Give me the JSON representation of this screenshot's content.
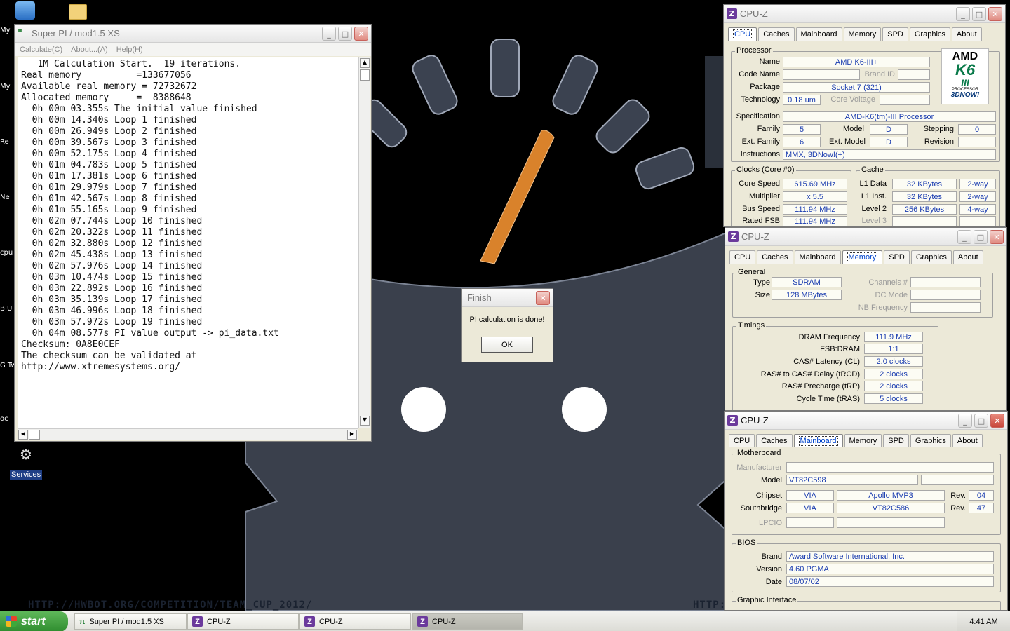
{
  "desktop": {
    "icons": [
      "My",
      "My",
      "Re",
      "Ne",
      "cpu",
      "B U",
      "G Tw",
      "oc"
    ],
    "services_label": "Services",
    "wallpaper_url_left": "HTTP://HWBOT.ORG/COMPETITION/TEAM_CUP_2012/",
    "wallpaper_url_right": "HTTP:"
  },
  "superpi": {
    "title": "Super PI / mod1.5 XS",
    "menu": [
      "Calculate(C)",
      "About...(A)",
      "Help(H)"
    ],
    "lines": [
      "   1M Calculation Start.  19 iterations.",
      "Real memory          =133677056",
      "Available real memory = 72732672",
      "Allocated memory     =  8388648",
      "  0h 00m 03.355s The initial value finished",
      "  0h 00m 14.340s Loop 1 finished",
      "  0h 00m 26.949s Loop 2 finished",
      "  0h 00m 39.567s Loop 3 finished",
      "  0h 00m 52.175s Loop 4 finished",
      "  0h 01m 04.783s Loop 5 finished",
      "  0h 01m 17.381s Loop 6 finished",
      "  0h 01m 29.979s Loop 7 finished",
      "  0h 01m 42.567s Loop 8 finished",
      "  0h 01m 55.165s Loop 9 finished",
      "  0h 02m 07.744s Loop 10 finished",
      "  0h 02m 20.322s Loop 11 finished",
      "  0h 02m 32.880s Loop 12 finished",
      "  0h 02m 45.438s Loop 13 finished",
      "  0h 02m 57.976s Loop 14 finished",
      "  0h 03m 10.474s Loop 15 finished",
      "  0h 03m 22.892s Loop 16 finished",
      "  0h 03m 35.139s Loop 17 finished",
      "  0h 03m 46.996s Loop 18 finished",
      "  0h 03m 57.972s Loop 19 finished",
      "  0h 04m 08.577s PI value output -> pi_data.txt",
      "",
      "Checksum: 0A8E0CEF",
      "The checksum can be validated at",
      "http://www.xtremesystems.org/"
    ]
  },
  "finish_dialog": {
    "title": "Finish",
    "message": "PI calculation is done!",
    "ok": "OK"
  },
  "cpuz": {
    "title": "CPU-Z",
    "tabs": [
      "CPU",
      "Caches",
      "Mainboard",
      "Memory",
      "SPD",
      "Graphics",
      "About"
    ],
    "cpu": {
      "processor_group": "Processor",
      "name_label": "Name",
      "name": "AMD K6-III+",
      "codename_label": "Code Name",
      "codename": "",
      "brandid_label": "Brand ID",
      "brandid": "",
      "package_label": "Package",
      "package": "Socket 7 (321)",
      "technology_label": "Technology",
      "technology": "0.18 um",
      "corevoltage_label": "Core Voltage",
      "corevoltage": "",
      "spec_label": "Specification",
      "spec": "AMD-K6(tm)-III Processor",
      "family_label": "Family",
      "family": "5",
      "model_label": "Model",
      "model": "D",
      "stepping_label": "Stepping",
      "stepping": "0",
      "extfamily_label": "Ext. Family",
      "extfamily": "6",
      "extmodel_label": "Ext. Model",
      "extmodel": "D",
      "revision_label": "Revision",
      "revision": "",
      "instructions_label": "Instructions",
      "instructions": "MMX, 3DNow!(+)",
      "logo_line1": "AMD",
      "logo_line2": "K6",
      "logo_line3": "III",
      "logo_line4": "PROCESSOR",
      "logo_line5": "3DNOW!",
      "clocks_group": "Clocks (Core #0)",
      "corespeed_label": "Core Speed",
      "corespeed": "615.69 MHz",
      "multiplier_label": "Multiplier",
      "multiplier": "x 5.5",
      "busspeed_label": "Bus Speed",
      "busspeed": "111.94 MHz",
      "ratedfsb_label": "Rated FSB",
      "ratedfsb": "111.94 MHz",
      "cache_group": "Cache",
      "l1data_label": "L1 Data",
      "l1data": "32 KBytes",
      "l1data_way": "2-way",
      "l1inst_label": "L1 Inst.",
      "l1inst": "32 KBytes",
      "l1inst_way": "2-way",
      "level2_label": "Level 2",
      "level2": "256 KBytes",
      "level2_way": "4-way",
      "level3_label": "Level 3",
      "level3": "",
      "level3_way": ""
    },
    "memory": {
      "general_group": "General",
      "type_label": "Type",
      "type": "SDRAM",
      "size_label": "Size",
      "size": "128 MBytes",
      "channels_label": "Channels #",
      "channels": "",
      "dcmode_label": "DC Mode",
      "dcmode": "",
      "nbfreq_label": "NB Frequency",
      "nbfreq": "",
      "timings_group": "Timings",
      "dramfreq_label": "DRAM Frequency",
      "dramfreq": "111.9 MHz",
      "fsbdram_label": "FSB:DRAM",
      "fsbdram": "1:1",
      "cas_label": "CAS# Latency (CL)",
      "cas": "2.0 clocks",
      "rcd_label": "RAS# to CAS# Delay (tRCD)",
      "rcd": "2 clocks",
      "rp_label": "RAS# Precharge (tRP)",
      "rp": "2 clocks",
      "ras_label": "Cycle Time (tRAS)",
      "ras": "5 clocks"
    },
    "mainboard": {
      "motherboard_group": "Motherboard",
      "manufacturer_label": "Manufacturer",
      "manufacturer": "",
      "model_label": "Model",
      "model": "VT82C598",
      "model_extra": "",
      "chipset_label": "Chipset",
      "chipset_vendor": "VIA",
      "chipset_name": "Apollo MVP3",
      "chipset_rev_label": "Rev.",
      "chipset_rev": "04",
      "southbridge_label": "Southbridge",
      "sb_vendor": "VIA",
      "sb_name": "VT82C586",
      "sb_rev_label": "Rev.",
      "sb_rev": "47",
      "lpcio_label": "LPCIO",
      "lpcio_vendor": "",
      "lpcio_name": "",
      "bios_group": "BIOS",
      "brand_label": "Brand",
      "brand": "Award Software International, Inc.",
      "version_label": "Version",
      "version": "4.60 PGMA",
      "date_label": "Date",
      "date": "08/07/02",
      "graphic_group": "Graphic Interface"
    }
  },
  "taskbar": {
    "start": "start",
    "items": [
      "Super PI / mod1.5 XS",
      "CPU-Z",
      "CPU-Z",
      "CPU-Z"
    ],
    "clock": "4:41 AM"
  },
  "colors": {
    "accent": "#0044cc",
    "needle": "#d9822b",
    "gauge": "#3b4250"
  }
}
